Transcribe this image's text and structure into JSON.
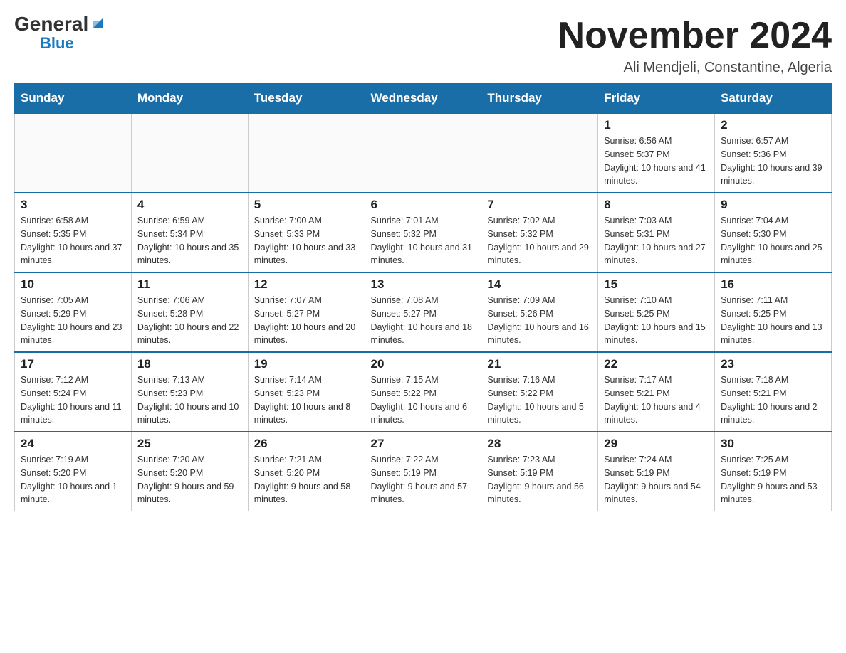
{
  "header": {
    "logo_general": "General",
    "logo_blue": "Blue",
    "month_title": "November 2024",
    "location": "Ali Mendjeli, Constantine, Algeria"
  },
  "weekdays": [
    "Sunday",
    "Monday",
    "Tuesday",
    "Wednesday",
    "Thursday",
    "Friday",
    "Saturday"
  ],
  "weeks": [
    {
      "days": [
        {
          "num": "",
          "info": ""
        },
        {
          "num": "",
          "info": ""
        },
        {
          "num": "",
          "info": ""
        },
        {
          "num": "",
          "info": ""
        },
        {
          "num": "",
          "info": ""
        },
        {
          "num": "1",
          "info": "Sunrise: 6:56 AM\nSunset: 5:37 PM\nDaylight: 10 hours and 41 minutes."
        },
        {
          "num": "2",
          "info": "Sunrise: 6:57 AM\nSunset: 5:36 PM\nDaylight: 10 hours and 39 minutes."
        }
      ]
    },
    {
      "days": [
        {
          "num": "3",
          "info": "Sunrise: 6:58 AM\nSunset: 5:35 PM\nDaylight: 10 hours and 37 minutes."
        },
        {
          "num": "4",
          "info": "Sunrise: 6:59 AM\nSunset: 5:34 PM\nDaylight: 10 hours and 35 minutes."
        },
        {
          "num": "5",
          "info": "Sunrise: 7:00 AM\nSunset: 5:33 PM\nDaylight: 10 hours and 33 minutes."
        },
        {
          "num": "6",
          "info": "Sunrise: 7:01 AM\nSunset: 5:32 PM\nDaylight: 10 hours and 31 minutes."
        },
        {
          "num": "7",
          "info": "Sunrise: 7:02 AM\nSunset: 5:32 PM\nDaylight: 10 hours and 29 minutes."
        },
        {
          "num": "8",
          "info": "Sunrise: 7:03 AM\nSunset: 5:31 PM\nDaylight: 10 hours and 27 minutes."
        },
        {
          "num": "9",
          "info": "Sunrise: 7:04 AM\nSunset: 5:30 PM\nDaylight: 10 hours and 25 minutes."
        }
      ]
    },
    {
      "days": [
        {
          "num": "10",
          "info": "Sunrise: 7:05 AM\nSunset: 5:29 PM\nDaylight: 10 hours and 23 minutes."
        },
        {
          "num": "11",
          "info": "Sunrise: 7:06 AM\nSunset: 5:28 PM\nDaylight: 10 hours and 22 minutes."
        },
        {
          "num": "12",
          "info": "Sunrise: 7:07 AM\nSunset: 5:27 PM\nDaylight: 10 hours and 20 minutes."
        },
        {
          "num": "13",
          "info": "Sunrise: 7:08 AM\nSunset: 5:27 PM\nDaylight: 10 hours and 18 minutes."
        },
        {
          "num": "14",
          "info": "Sunrise: 7:09 AM\nSunset: 5:26 PM\nDaylight: 10 hours and 16 minutes."
        },
        {
          "num": "15",
          "info": "Sunrise: 7:10 AM\nSunset: 5:25 PM\nDaylight: 10 hours and 15 minutes."
        },
        {
          "num": "16",
          "info": "Sunrise: 7:11 AM\nSunset: 5:25 PM\nDaylight: 10 hours and 13 minutes."
        }
      ]
    },
    {
      "days": [
        {
          "num": "17",
          "info": "Sunrise: 7:12 AM\nSunset: 5:24 PM\nDaylight: 10 hours and 11 minutes."
        },
        {
          "num": "18",
          "info": "Sunrise: 7:13 AM\nSunset: 5:23 PM\nDaylight: 10 hours and 10 minutes."
        },
        {
          "num": "19",
          "info": "Sunrise: 7:14 AM\nSunset: 5:23 PM\nDaylight: 10 hours and 8 minutes."
        },
        {
          "num": "20",
          "info": "Sunrise: 7:15 AM\nSunset: 5:22 PM\nDaylight: 10 hours and 6 minutes."
        },
        {
          "num": "21",
          "info": "Sunrise: 7:16 AM\nSunset: 5:22 PM\nDaylight: 10 hours and 5 minutes."
        },
        {
          "num": "22",
          "info": "Sunrise: 7:17 AM\nSunset: 5:21 PM\nDaylight: 10 hours and 4 minutes."
        },
        {
          "num": "23",
          "info": "Sunrise: 7:18 AM\nSunset: 5:21 PM\nDaylight: 10 hours and 2 minutes."
        }
      ]
    },
    {
      "days": [
        {
          "num": "24",
          "info": "Sunrise: 7:19 AM\nSunset: 5:20 PM\nDaylight: 10 hours and 1 minute."
        },
        {
          "num": "25",
          "info": "Sunrise: 7:20 AM\nSunset: 5:20 PM\nDaylight: 9 hours and 59 minutes."
        },
        {
          "num": "26",
          "info": "Sunrise: 7:21 AM\nSunset: 5:20 PM\nDaylight: 9 hours and 58 minutes."
        },
        {
          "num": "27",
          "info": "Sunrise: 7:22 AM\nSunset: 5:19 PM\nDaylight: 9 hours and 57 minutes."
        },
        {
          "num": "28",
          "info": "Sunrise: 7:23 AM\nSunset: 5:19 PM\nDaylight: 9 hours and 56 minutes."
        },
        {
          "num": "29",
          "info": "Sunrise: 7:24 AM\nSunset: 5:19 PM\nDaylight: 9 hours and 54 minutes."
        },
        {
          "num": "30",
          "info": "Sunrise: 7:25 AM\nSunset: 5:19 PM\nDaylight: 9 hours and 53 minutes."
        }
      ]
    }
  ]
}
